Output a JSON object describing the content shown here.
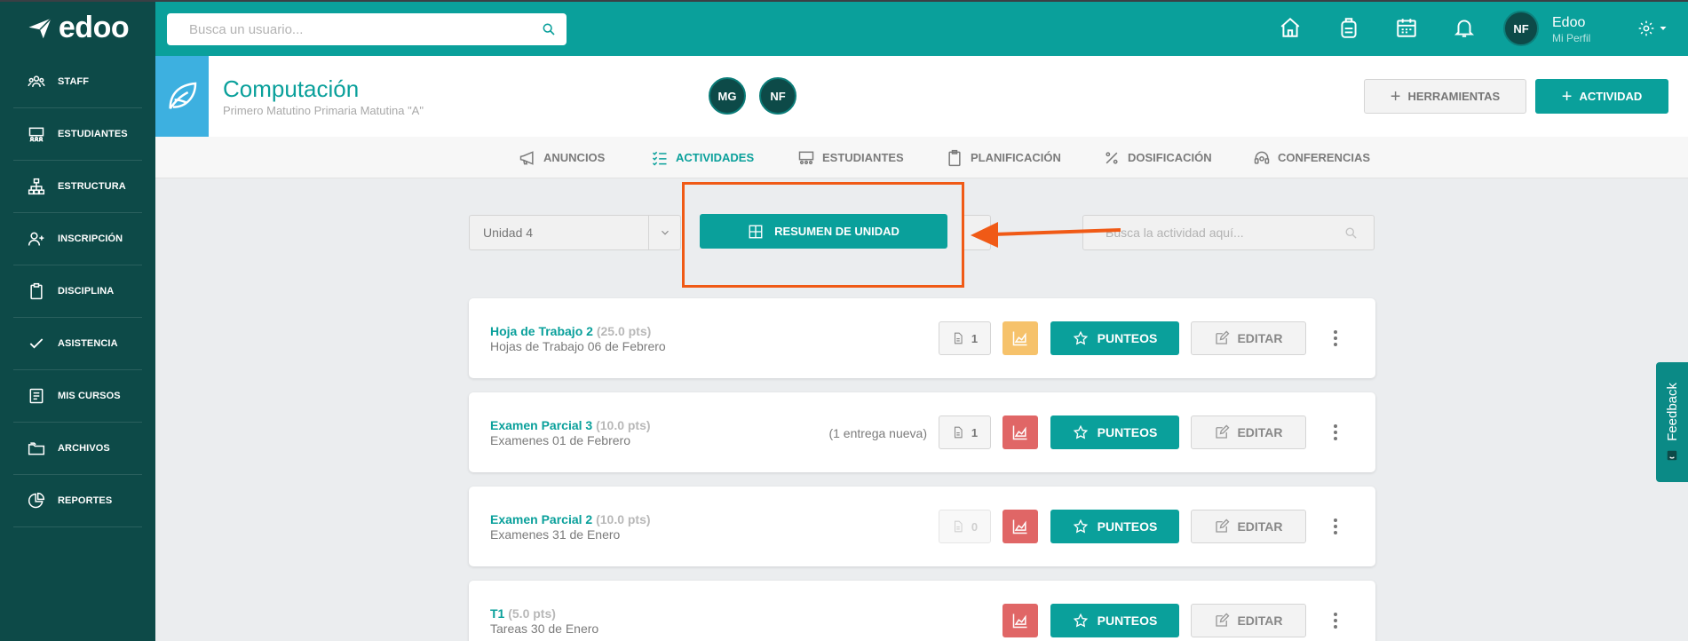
{
  "app": {
    "name": "edoo"
  },
  "sidebar": {
    "items": [
      {
        "label": "STAFF",
        "icon": "staff-icon"
      },
      {
        "label": "ESTUDIANTES",
        "icon": "students-icon"
      },
      {
        "label": "ESTRUCTURA",
        "icon": "structure-icon"
      },
      {
        "label": "INSCRIPCIÓN",
        "icon": "add-user-icon"
      },
      {
        "label": "DISCIPLINA",
        "icon": "clipboard-icon"
      },
      {
        "label": "ASISTENCIA",
        "icon": "check-icon"
      },
      {
        "label": "MIS CURSOS",
        "icon": "book-icon"
      },
      {
        "label": "ARCHIVOS",
        "icon": "folder-icon"
      },
      {
        "label": "REPORTES",
        "icon": "pie-chart-icon"
      }
    ]
  },
  "topbar": {
    "search_placeholder": "Busca un usuario...",
    "icons": [
      "home-icon",
      "backpack-icon",
      "calendar-icon",
      "bell-icon"
    ],
    "avatar_initials": "NF",
    "profile_name": "Edoo",
    "profile_sub": "Mi Perfil"
  },
  "course": {
    "title": "Computación",
    "subtitle": "Primero Matutino Primaria Matutina \"A\"",
    "teachers": [
      "MG",
      "NF"
    ],
    "tools_label": "HERRAMIENTAS",
    "activity_label": "ACTIVIDAD"
  },
  "tabs": [
    {
      "label": "ANUNCIOS",
      "icon": "megaphone-icon",
      "active": false
    },
    {
      "label": "ACTIVIDADES",
      "icon": "checklist-icon",
      "active": true
    },
    {
      "label": "ESTUDIANTES",
      "icon": "students-icon",
      "active": false
    },
    {
      "label": "PLANIFICACIÓN",
      "icon": "clipboard-icon",
      "active": false
    },
    {
      "label": "DOSIFICACIÓN",
      "icon": "percent-icon",
      "active": false
    },
    {
      "label": "CONFERENCIAS",
      "icon": "headset-icon",
      "active": false
    }
  ],
  "filters": {
    "unit_value": "Unidad 4",
    "resumen_label": "RESUMEN DE UNIDAD",
    "search_placeholder": "Busca la actividad aquí..."
  },
  "activities": [
    {
      "title": "Hoja de Trabajo 2",
      "pts": "(25.0 pts)",
      "subtitle": "Hojas de Trabajo 06 de Febrero",
      "entrega": "",
      "files": "1",
      "files_disabled": false,
      "chart_color": "#f6c26b",
      "punteos": "PUNTEOS",
      "editar": "EDITAR"
    },
    {
      "title": "Examen Parcial 3",
      "pts": "(10.0 pts)",
      "subtitle": "Examenes 01 de Febrero",
      "entrega": "(1 entrega nueva)",
      "files": "1",
      "files_disabled": false,
      "chart_color": "#e06666",
      "punteos": "PUNTEOS",
      "editar": "EDITAR"
    },
    {
      "title": "Examen Parcial 2",
      "pts": "(10.0 pts)",
      "subtitle": "Examenes 31 de Enero",
      "entrega": "",
      "files": "0",
      "files_disabled": true,
      "chart_color": "#e06666",
      "punteos": "PUNTEOS",
      "editar": "EDITAR"
    },
    {
      "title": "T1",
      "pts": "(5.0 pts)",
      "subtitle": "Tareas 30 de Enero",
      "entrega": "",
      "files": "",
      "files_disabled": false,
      "chart_color": "#e06666",
      "punteos": "PUNTEOS",
      "editar": "EDITAR"
    }
  ],
  "feedback": {
    "label": "Feedback"
  },
  "colors": {
    "primary": "#0aa09b",
    "sidebar": "#0d4a48",
    "annotation": "#f05a16"
  }
}
